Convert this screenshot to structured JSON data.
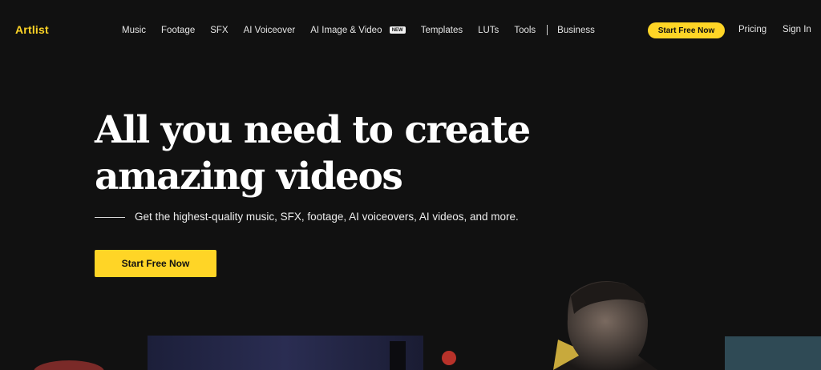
{
  "nav": {
    "logo": "Artlist",
    "links": [
      "Music",
      "Footage",
      "SFX",
      "AI Voiceover",
      "AI Image & Video",
      "Templates",
      "LUTs",
      "Tools",
      "Business"
    ],
    "new_badge": "NEW",
    "cta": "Start Free Now",
    "pricing": "Pricing",
    "sign_in": "Sign In"
  },
  "hero": {
    "title_line1": "All you need to create",
    "title_line2": "amazing videos",
    "subtitle": "Get the highest-quality music, SFX, footage, AI voiceovers, AI videos, and more.",
    "cta": "Start Free Now"
  },
  "colors": {
    "background": "#111111",
    "accent": "#ffd526",
    "text": "#ffffff"
  }
}
